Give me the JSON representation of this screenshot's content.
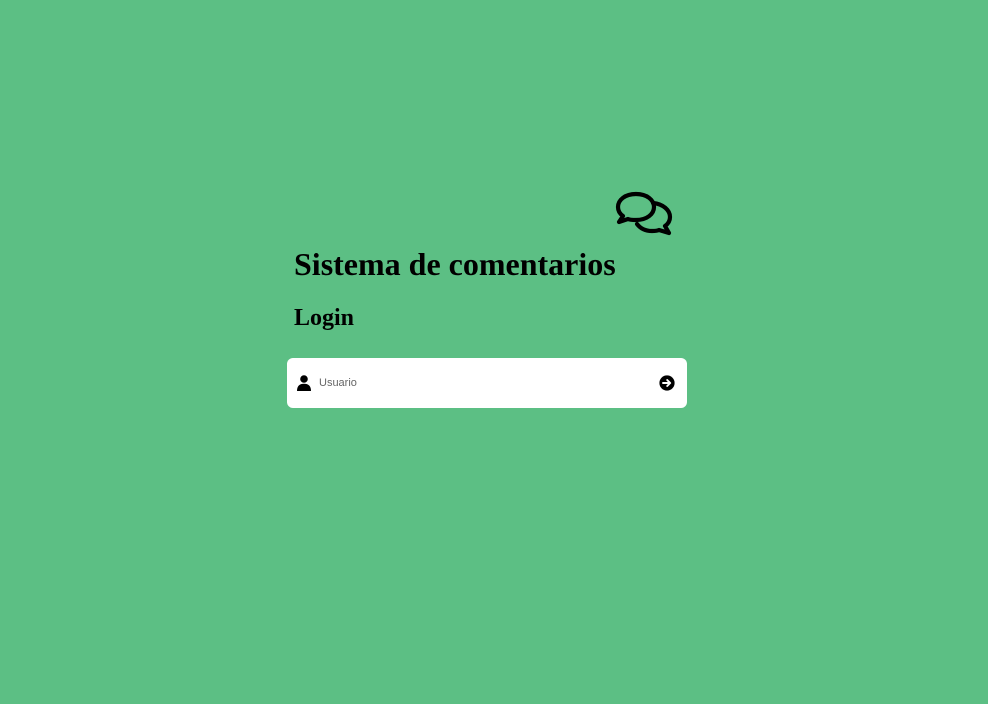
{
  "header": {
    "logo_icon": "comments-icon",
    "title": "Sistema de comentarios"
  },
  "login": {
    "heading": "Login",
    "username": {
      "icon": "user-icon",
      "placeholder": "Usuario",
      "value": ""
    },
    "submit_icon": "arrow-circle-right-icon"
  },
  "theme": {
    "background": "#5cbf84",
    "card": "#ffffff",
    "text": "#000000"
  }
}
